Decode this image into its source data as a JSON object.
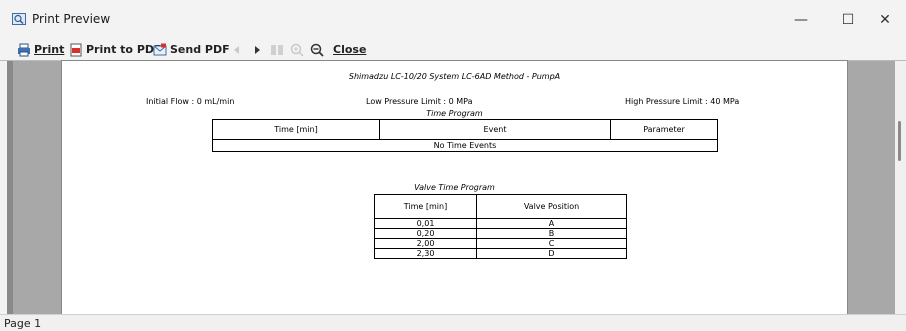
{
  "window": {
    "title": "Print Preview",
    "controls": {
      "minimize": "—",
      "maximize": "☐",
      "close": "✕"
    }
  },
  "toolbar": {
    "print_label": "Print",
    "print_pdf_label": "Print to PDF",
    "send_pdf_label": "Send PDF",
    "close_label": "Close"
  },
  "document": {
    "header": "Shimadzu  LC-10/20 System  LC-6AD Method - PumpA",
    "initial_flow": "Initial Flow   : 0 mL/min",
    "low_pressure": "Low Pressure Limit   : 0 MPa",
    "high_pressure": "High Pressure Limit   : 40 MPa",
    "time_program": {
      "title": "Time Program",
      "headers": [
        "Time [min]",
        "Event",
        "Parameter"
      ],
      "empty_text": "No Time Events"
    },
    "valve_program": {
      "title": "Valve Time Program",
      "headers": [
        "Time [min]",
        "Valve Position"
      ],
      "rows": [
        {
          "time": "0,01",
          "position": "A"
        },
        {
          "time": "0,20",
          "position": "B"
        },
        {
          "time": "2,00",
          "position": "C"
        },
        {
          "time": "2,30",
          "position": "D"
        }
      ]
    }
  },
  "status": {
    "page": "Page 1"
  }
}
